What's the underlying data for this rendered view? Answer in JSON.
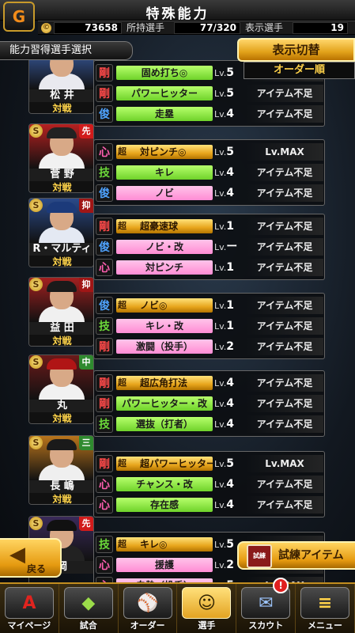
{
  "header": {
    "title": "特殊能力",
    "coin_value": "73658",
    "owned_label": "所持選手",
    "owned_value": "77/320",
    "shown_label": "表示選手",
    "shown_value": "19"
  },
  "section_label": "能力習得選手選択",
  "toggle": {
    "label": "表示切替",
    "order": "オーダー順"
  },
  "players": [
    {
      "name": "松 井",
      "mode": "対戦",
      "position": "",
      "rank_badge": "",
      "abilities": [
        {
          "cat": "剛",
          "super": false,
          "name": "固め打ち◎",
          "lv": "5",
          "status": ""
        },
        {
          "cat": "剛",
          "super": false,
          "name": "パワーヒッター",
          "lv": "5",
          "status": "アイテム不足"
        },
        {
          "cat": "俊",
          "super": false,
          "name": "走塁",
          "lv": "4",
          "status": "アイテム不足"
        }
      ]
    },
    {
      "name": "菅 野",
      "mode": "対戦",
      "position": "先",
      "rank_badge": "S",
      "abilities": [
        {
          "cat": "心",
          "super": true,
          "name": "対ピンチ◎",
          "lv": "5",
          "status": "Lv.MAX"
        },
        {
          "cat": "技",
          "super": false,
          "name": "キレ",
          "lv": "4",
          "status": "アイテム不足"
        },
        {
          "cat": "俊",
          "super": false,
          "name": "ノビ",
          "lv": "4",
          "status": "アイテム不足"
        }
      ]
    },
    {
      "name": "R・マルティネス",
      "mode": "対戦",
      "position": "抑",
      "rank_badge": "S",
      "abilities": [
        {
          "cat": "剛",
          "super": true,
          "name": "超豪速球",
          "lv": "1",
          "status": "アイテム不足"
        },
        {
          "cat": "俊",
          "super": false,
          "name": "ノビ・改",
          "lv": "ー",
          "status": "アイテム不足"
        },
        {
          "cat": "心",
          "super": false,
          "name": "対ピンチ",
          "lv": "1",
          "status": "アイテム不足"
        }
      ]
    },
    {
      "name": "益 田",
      "mode": "対戦",
      "position": "抑",
      "rank_badge": "S",
      "abilities": [
        {
          "cat": "俊",
          "super": true,
          "name": "ノビ◎",
          "lv": "1",
          "status": "アイテム不足"
        },
        {
          "cat": "技",
          "super": false,
          "name": "キレ・改",
          "lv": "1",
          "status": "アイテム不足"
        },
        {
          "cat": "剛",
          "super": false,
          "name": "激闘（投手）",
          "lv": "2",
          "status": "アイテム不足"
        }
      ]
    },
    {
      "name": "丸",
      "mode": "対戦",
      "position": "中",
      "rank_badge": "S",
      "abilities": [
        {
          "cat": "剛",
          "super": true,
          "name": "超広角打法",
          "lv": "4",
          "status": "アイテム不足"
        },
        {
          "cat": "剛",
          "super": false,
          "name": "パワーヒッター・改",
          "lv": "4",
          "status": "アイテム不足"
        },
        {
          "cat": "技",
          "super": false,
          "name": "選抜（打者）",
          "lv": "4",
          "status": "アイテム不足"
        }
      ]
    },
    {
      "name": "長 嶋",
      "mode": "対戦",
      "position": "三",
      "rank_badge": "S",
      "abilities": [
        {
          "cat": "剛",
          "super": true,
          "name": "超パワーヒッター",
          "lv": "5",
          "status": "Lv.MAX"
        },
        {
          "cat": "心",
          "super": false,
          "name": "チャンス・改",
          "lv": "4",
          "status": "アイテム不足"
        },
        {
          "cat": "心",
          "super": false,
          "name": "存在感",
          "lv": "4",
          "status": "アイテム不足"
        }
      ]
    },
    {
      "name": "岡",
      "mode": "",
      "position": "先",
      "rank_badge": "S",
      "abilities": [
        {
          "cat": "技",
          "super": true,
          "name": "キレ◎",
          "lv": "5",
          "status": ""
        },
        {
          "cat": "心",
          "super": false,
          "name": "援護",
          "lv": "2",
          "status": ""
        },
        {
          "cat": "心",
          "super": false,
          "name": "白熱（投手）",
          "lv": "5",
          "status": "Lv.MAX"
        }
      ]
    }
  ],
  "super_tag": "超",
  "lv_prefix": "Lv.",
  "back_button": "戻る",
  "trial_button": {
    "label": "試練アイテム",
    "book_text": "試練"
  },
  "nav": [
    {
      "label": "マイページ",
      "icon": "A"
    },
    {
      "label": "試合",
      "icon": "◆"
    },
    {
      "label": "オーダー",
      "icon": "⚾"
    },
    {
      "label": "選手",
      "icon": "☺"
    },
    {
      "label": "スカウト",
      "icon": "✉"
    },
    {
      "label": "メニュー",
      "icon": "≡"
    }
  ],
  "notification_badge": "!"
}
